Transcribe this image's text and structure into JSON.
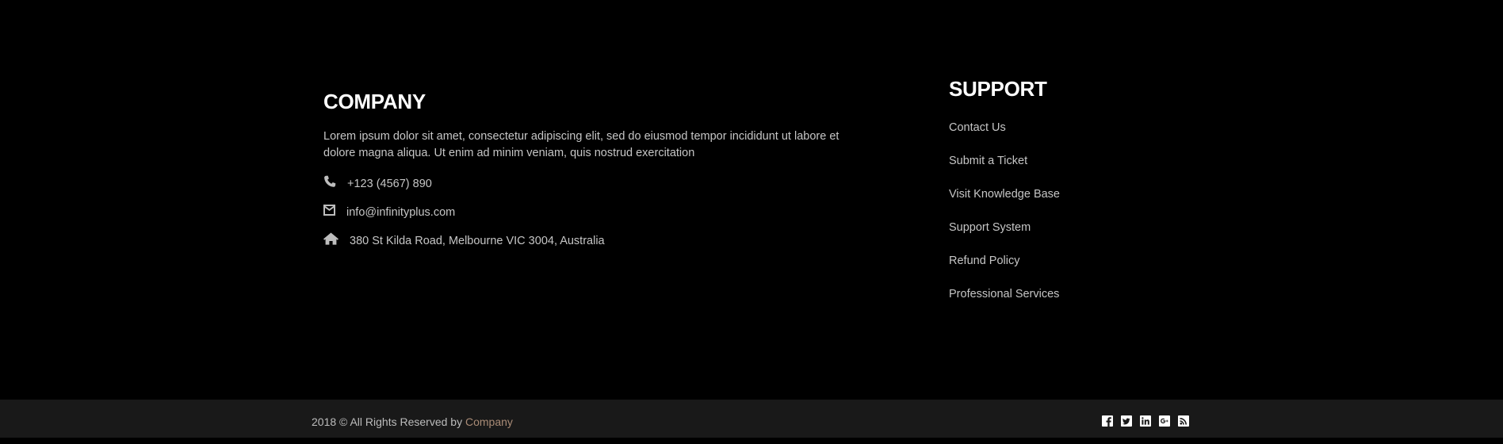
{
  "company": {
    "heading": "COMPANY",
    "about": "Lorem ipsum dolor sit amet, consectetur adipiscing elit, sed do eiusmod tempor incididunt ut labore et dolore magna aliqua. Ut enim ad minim veniam, quis nostrud exercitation",
    "contacts": [
      {
        "icon": "phone-icon",
        "text": "+123 (4567) 890"
      },
      {
        "icon": "envelope-icon",
        "text": "info@infinityplus.com"
      },
      {
        "icon": "home-icon",
        "text": "380 St Kilda Road, Melbourne VIC 3004, Australia"
      }
    ]
  },
  "support": {
    "heading": "SUPPORT",
    "links": [
      {
        "label": "Contact Us"
      },
      {
        "label": "Submit a Ticket"
      },
      {
        "label": "Visit Knowledge Base"
      },
      {
        "label": "Support System"
      },
      {
        "label": "Refund Policy"
      },
      {
        "label": "Professional Services"
      }
    ]
  },
  "bottom_bar": {
    "copyright_prefix": "2018 © All Rights Reserved by",
    "brand_link": "Company",
    "social": [
      {
        "icon": "facebook-icon"
      },
      {
        "icon": "twitter-icon"
      },
      {
        "icon": "linkedin-icon"
      },
      {
        "icon": "google-plus-icon"
      },
      {
        "icon": "rss-icon"
      }
    ]
  },
  "colors": {
    "background": "#000000",
    "bottom_bar": "#191919",
    "heading": "#ffffff",
    "text": "#c6c6c6",
    "brand_link": "#a98b76"
  }
}
